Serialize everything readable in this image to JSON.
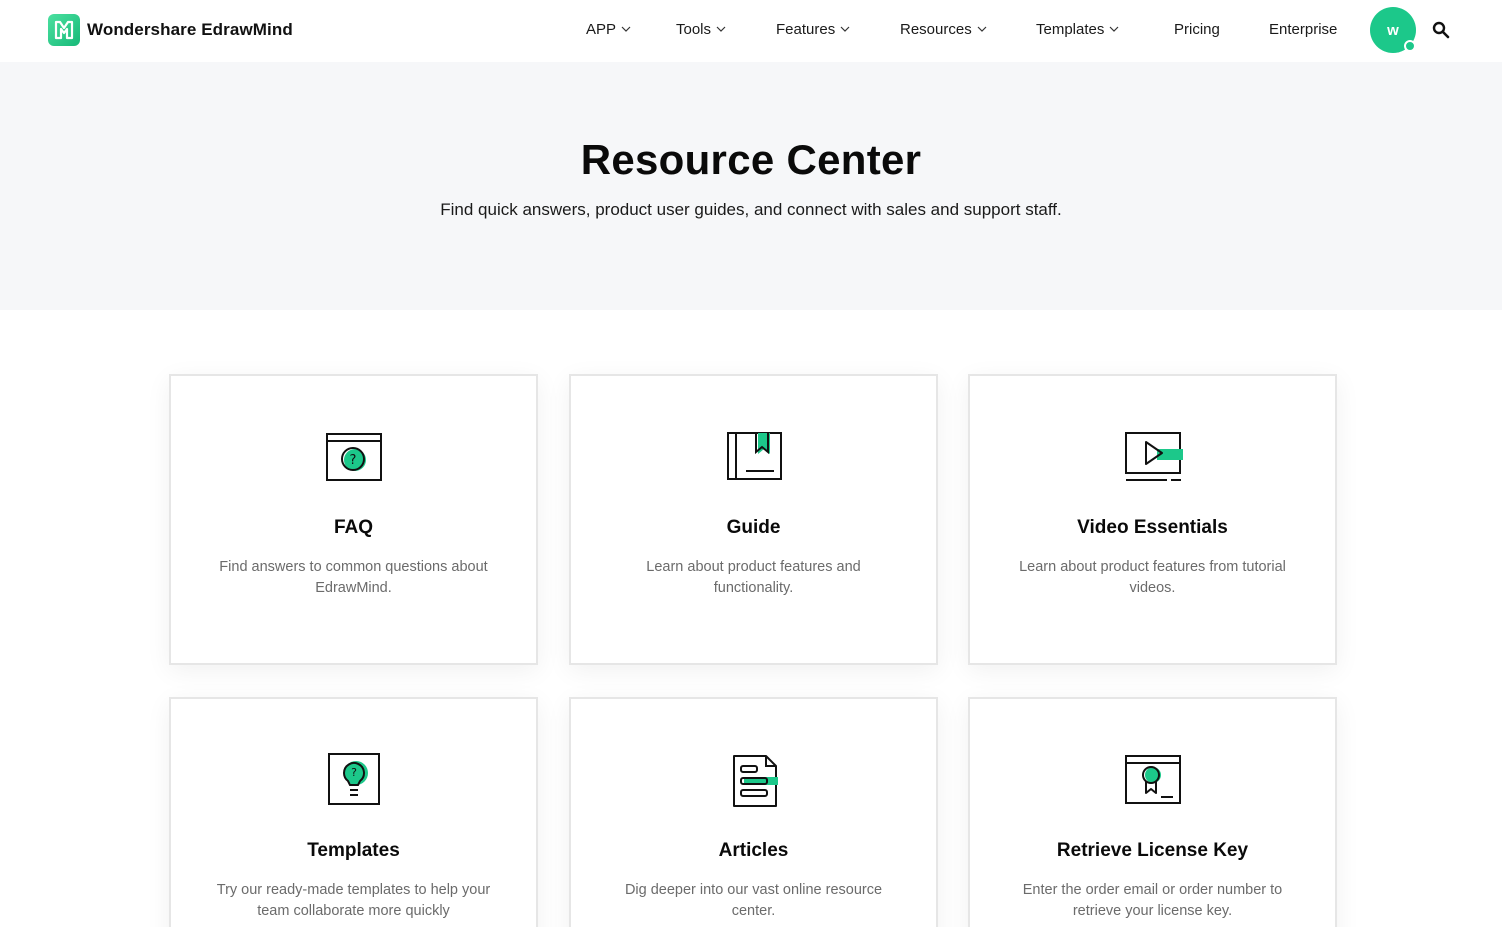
{
  "header": {
    "brand": "Wondershare EdrawMind",
    "nav": [
      {
        "label": "APP",
        "dropdown": true
      },
      {
        "label": "Tools",
        "dropdown": true
      },
      {
        "label": "Features",
        "dropdown": true
      },
      {
        "label": "Resources",
        "dropdown": true
      },
      {
        "label": "Templates",
        "dropdown": true
      },
      {
        "label": "Pricing",
        "dropdown": false
      },
      {
        "label": "Enterprise",
        "dropdown": false
      }
    ],
    "avatar_initial": "w",
    "search_icon": "search-icon"
  },
  "hero": {
    "title": "Resource Center",
    "subtitle": "Find quick answers, product user guides, and connect with sales and support staff."
  },
  "cards": [
    {
      "title": "FAQ",
      "desc": "Find answers to common questions about EdrawMind.",
      "icon": "faq-icon"
    },
    {
      "title": "Guide",
      "desc": "Learn about product features and functionality.",
      "icon": "guide-book-icon"
    },
    {
      "title": "Video Essentials",
      "desc": "Learn about product features from tutorial videos.",
      "icon": "video-player-icon"
    },
    {
      "title": "Templates",
      "desc": "Try our ready-made templates to help your team collaborate more quickly",
      "icon": "lightbulb-icon"
    },
    {
      "title": "Articles",
      "desc": "Dig deeper into our vast online resource center.",
      "icon": "article-document-icon"
    },
    {
      "title": "Retrieve License Key",
      "desc": "Enter the order email or order number to retrieve your license key.",
      "icon": "license-certificate-icon"
    }
  ],
  "colors": {
    "accent": "#1cc88a",
    "hero_bg": "#f6f7f9"
  }
}
